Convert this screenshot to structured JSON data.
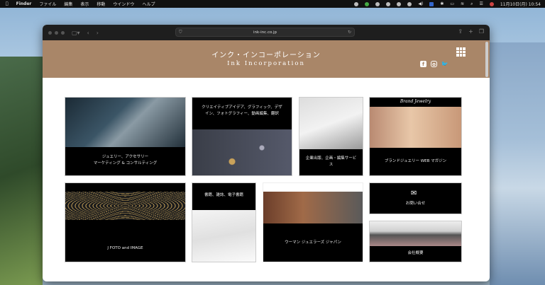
{
  "menubar": {
    "app": "Finder",
    "items": [
      "ファイル",
      "編集",
      "表示",
      "移動",
      "ウインドウ",
      "ヘルプ"
    ],
    "clock": "11月10日(月) 10:54"
  },
  "browser": {
    "url": "ink-inc.co.jp"
  },
  "header": {
    "title_jp": "インク・インコーポレーション",
    "title_en": "Ink Incorporation",
    "social": [
      "facebook",
      "instagram",
      "twitter"
    ],
    "accent": "#a98668"
  },
  "tiles": [
    {
      "caption_1": "ジュエリー、アクセサリー",
      "caption_2": "マーケティング & コンサルティング"
    },
    {
      "caption_1": "クリエイティブアイデア、グラフィック、デザ",
      "caption_2": "イン、フォトグラフィー、動画編集、翻訳"
    },
    {
      "caption_1": "企業出版、企画・編集サービ",
      "caption_2": "ス"
    },
    {
      "caption": "ブランドジュエリー WEB マガジン",
      "banner": "Brand Jewelry"
    },
    {
      "caption": "J FOTO and IMAGE"
    },
    {
      "caption": "書籍、雑誌、電子書籍"
    },
    {
      "caption": "ウーマン ジュエラーズ ジャパン"
    },
    {
      "caption": "お問い合せ"
    },
    {
      "caption": "会社概要"
    }
  ]
}
